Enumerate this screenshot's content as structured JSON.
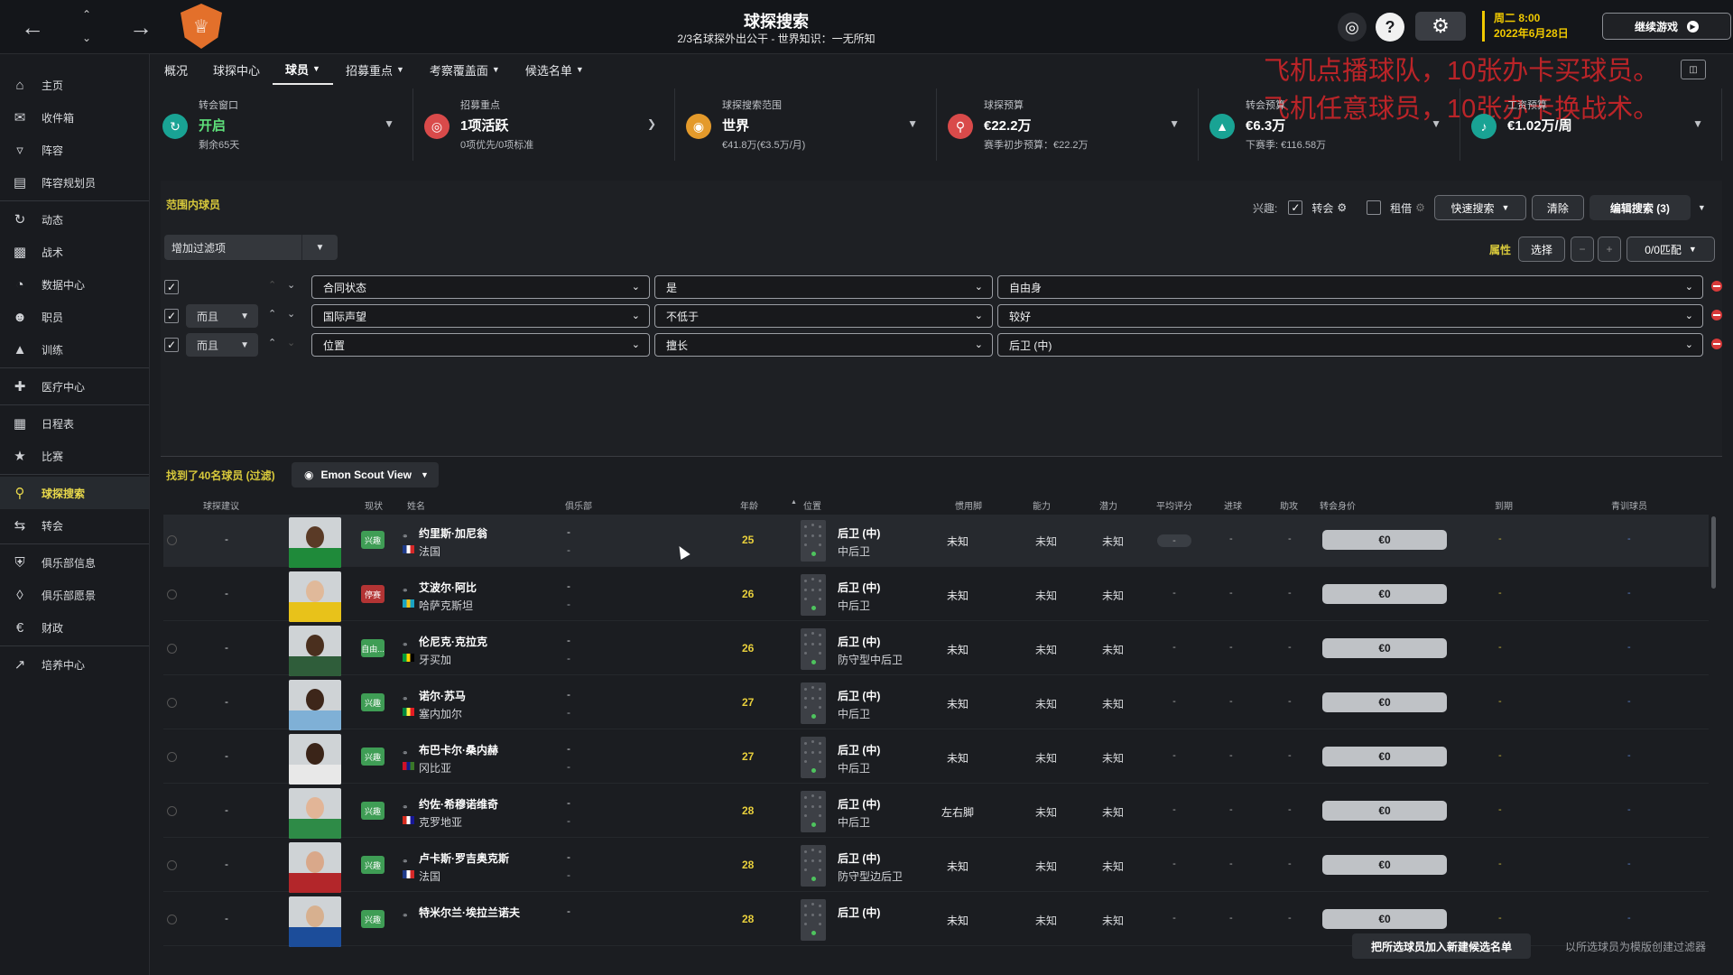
{
  "header": {
    "title": "球探搜索",
    "subtitle": "2/3名球探外出公干 - 世界知识：一无所知",
    "date_line1": "周二 8:00",
    "date_line2": "2022年6月28日",
    "continue_label": "继续游戏"
  },
  "overlay_text": [
    "飞机点播球队，10张办卡买球员。",
    "飞机任意球员，10张办卡换战术。"
  ],
  "sidebar": {
    "items": [
      {
        "label": "主页",
        "icon": "home-icon"
      },
      {
        "label": "收件箱",
        "icon": "inbox-icon"
      },
      {
        "label": "阵容",
        "icon": "shirt-icon"
      },
      {
        "label": "阵容规划员",
        "icon": "clipboard-icon"
      },
      {
        "label": "动态",
        "icon": "dynamics-icon"
      },
      {
        "label": "战术",
        "icon": "tactics-icon"
      },
      {
        "label": "数据中心",
        "icon": "data-icon"
      },
      {
        "label": "职员",
        "icon": "staff-icon"
      },
      {
        "label": "训练",
        "icon": "training-icon"
      },
      {
        "label": "医疗中心",
        "icon": "medical-icon"
      },
      {
        "label": "日程表",
        "icon": "calendar-icon"
      },
      {
        "label": "比赛",
        "icon": "trophy-icon"
      },
      {
        "label": "球探搜索",
        "icon": "search-icon"
      },
      {
        "label": "转会",
        "icon": "transfer-icon"
      },
      {
        "label": "俱乐部信息",
        "icon": "shield-icon"
      },
      {
        "label": "俱乐部愿景",
        "icon": "vision-icon"
      },
      {
        "label": "财政",
        "icon": "finance-icon"
      },
      {
        "label": "培养中心",
        "icon": "development-icon"
      }
    ]
  },
  "tabs": [
    {
      "label": "概况",
      "dropdown": false
    },
    {
      "label": "球探中心",
      "dropdown": false
    },
    {
      "label": "球员",
      "dropdown": true
    },
    {
      "label": "招募重点",
      "dropdown": true
    },
    {
      "label": "考察覆盖面",
      "dropdown": true
    },
    {
      "label": "候选名单",
      "dropdown": true
    }
  ],
  "stats": [
    {
      "label": "转会窗口",
      "value": "开启",
      "sub": "剩余65天",
      "color": "#19a394"
    },
    {
      "label": "招募重点",
      "value": "1项活跃",
      "sub": "0项优先/0项标准",
      "color": "#d94a4a"
    },
    {
      "label": "球探搜索范围",
      "value": "世界",
      "sub": "€41.8万(€3.5万/月)",
      "color": "#e49a2b"
    },
    {
      "label": "球探预算",
      "value": "€22.2万",
      "sub": "赛季初步预算：€22.2万",
      "color": "#d94a4a"
    },
    {
      "label": "转会预算",
      "value": "€6.3万",
      "sub": "下赛季: €116.58万",
      "color": "#19a394"
    },
    {
      "label": "工资预算",
      "value": "€1.02万/周",
      "sub": "",
      "color": "#19a394"
    }
  ],
  "filters": {
    "range_label": "范围内球员",
    "interest_label": "兴趣:",
    "transfer_label": "转会",
    "loan_label": "租借",
    "quick_search": "快速搜索",
    "clear": "清除",
    "edit_search": "编辑搜索 (3)",
    "add_filter": "增加过滤项",
    "attr_label": "属性",
    "select_label": "选择",
    "match_label": "0/0匹配",
    "rows": [
      {
        "conj": "",
        "field": "合同状态",
        "op": "是",
        "value": "自由身"
      },
      {
        "conj": "而且",
        "field": "国际声望",
        "op": "不低于",
        "value": "较好"
      },
      {
        "conj": "而且",
        "field": "位置",
        "op": "擅长",
        "value": "后卫 (中)"
      }
    ]
  },
  "results": {
    "found": "找到了40名球员 (过滤)",
    "view": "Emon Scout View"
  },
  "table": {
    "headers": [
      "球探建议",
      "现状",
      "姓名",
      "俱乐部",
      "年龄",
      "位置",
      "惯用脚",
      "能力",
      "潜力",
      "平均评分",
      "进球",
      "助攻",
      "转会身价",
      "到期",
      "青训球员"
    ],
    "rows": [
      {
        "rec": "-",
        "badge": "兴趣",
        "badge_color": "#3f9d55",
        "name": "约里斯·加尼翁",
        "nation": "法国",
        "club": "-",
        "club2": "-",
        "age": "25",
        "pos": "后卫 (中)",
        "role": "中后卫",
        "foot": "未知",
        "ability": "未知",
        "potential": "未知",
        "rating": "-",
        "goals": "-",
        "assists": "-",
        "value": "€0",
        "expiry": "-",
        "youth": "-",
        "skin": "#5a3a26",
        "shirt": "#1f8a3a",
        "flag": [
          "#1e3a8a",
          "#ffffff",
          "#d62828"
        ]
      },
      {
        "rec": "-",
        "badge": "停赛",
        "badge_color": "#b33434",
        "name": "艾波尔·阿比",
        "nation": "哈萨克斯坦",
        "club": "-",
        "club2": "-",
        "age": "26",
        "pos": "后卫 (中)",
        "role": "中后卫",
        "foot": "未知",
        "ability": "未知",
        "potential": "未知",
        "rating": "-",
        "goals": "-",
        "assists": "-",
        "value": "€0",
        "expiry": "-",
        "youth": "-",
        "skin": "#e0b99a",
        "shirt": "#e8c21a",
        "flag": [
          "#19a2c2",
          "#f0c419",
          "#19a2c2"
        ]
      },
      {
        "rec": "-",
        "badge": "自由...",
        "badge_color": "#3f9d55",
        "name": "伦尼克·克拉克",
        "nation": "牙买加",
        "club": "-",
        "club2": "-",
        "age": "26",
        "pos": "后卫 (中)",
        "role": "防守型中后卫",
        "foot": "未知",
        "ability": "未知",
        "potential": "未知",
        "rating": "-",
        "goals": "-",
        "assists": "-",
        "value": "€0",
        "expiry": "-",
        "youth": "-",
        "skin": "#4a2f1e",
        "shirt": "#2f5d3a",
        "flag": [
          "#009b3a",
          "#fed100",
          "#000000"
        ]
      },
      {
        "rec": "-",
        "badge": "兴趣",
        "badge_color": "#3f9d55",
        "name": "诺尔·苏马",
        "nation": "塞内加尔",
        "club": "-",
        "club2": "-",
        "age": "27",
        "pos": "后卫 (中)",
        "role": "中后卫",
        "foot": "未知",
        "ability": "未知",
        "potential": "未知",
        "rating": "-",
        "goals": "-",
        "assists": "-",
        "value": "€0",
        "expiry": "-",
        "youth": "-",
        "skin": "#3d261a",
        "shirt": "#7fb0d6",
        "flag": [
          "#00853f",
          "#fdef42",
          "#e31b23"
        ]
      },
      {
        "rec": "-",
        "badge": "兴趣",
        "badge_color": "#3f9d55",
        "name": "布巴卡尔·桑内赫",
        "nation": "冈比亚",
        "club": "-",
        "club2": "-",
        "age": "27",
        "pos": "后卫 (中)",
        "role": "中后卫",
        "foot": "未知",
        "ability": "未知",
        "potential": "未知",
        "rating": "-",
        "goals": "-",
        "assists": "-",
        "value": "€0",
        "expiry": "-",
        "youth": "-",
        "skin": "#3a2418",
        "shirt": "#e8e8e8",
        "flag": [
          "#ce1126",
          "#0c1c8c",
          "#3a7728"
        ]
      },
      {
        "rec": "-",
        "badge": "兴趣",
        "badge_color": "#3f9d55",
        "name": "约佐·希穆诺维奇",
        "nation": "克罗地亚",
        "club": "-",
        "club2": "-",
        "age": "28",
        "pos": "后卫 (中)",
        "role": "中后卫",
        "foot": "左右脚",
        "ability": "未知",
        "potential": "未知",
        "rating": "-",
        "goals": "-",
        "assists": "-",
        "value": "€0",
        "expiry": "-",
        "youth": "-",
        "skin": "#e2b597",
        "shirt": "#2e8b47",
        "flag": [
          "#d52b1e",
          "#ffffff",
          "#171796"
        ]
      },
      {
        "rec": "-",
        "badge": "兴趣",
        "badge_color": "#3f9d55",
        "name": "卢卡斯·罗吉奥克斯",
        "nation": "法国",
        "club": "-",
        "club2": "-",
        "age": "28",
        "pos": "后卫 (中)",
        "role": "防守型边后卫",
        "foot": "未知",
        "ability": "未知",
        "potential": "未知",
        "rating": "-",
        "goals": "-",
        "assists": "-",
        "value": "€0",
        "expiry": "-",
        "youth": "-",
        "skin": "#d9a88a",
        "shirt": "#b3262a",
        "flag": [
          "#1e3a8a",
          "#ffffff",
          "#d62828"
        ]
      },
      {
        "rec": "-",
        "badge": "兴趣",
        "badge_color": "#3f9d55",
        "name": "特米尔兰·埃拉兰诺夫",
        "nation": "",
        "club": "-",
        "club2": "",
        "age": "28",
        "pos": "后卫 (中)",
        "role": "",
        "foot": "未知",
        "ability": "未知",
        "potential": "未知",
        "rating": "-",
        "goals": "-",
        "assists": "-",
        "value": "€0",
        "expiry": "-",
        "youth": "-",
        "skin": "#d7b08f",
        "shirt": "#1c4d9a",
        "flag": [
          "#19a2c2",
          "#f0c419",
          "#19a2c2"
        ]
      }
    ]
  },
  "bottom": {
    "add_shortlist": "把所选球员加入新建候选名单",
    "create_filter": "以所选球员为模版创建过滤器"
  },
  "colors": {
    "accent_yellow": "#d7c83b",
    "age_yellow": "#e8cf3c"
  }
}
